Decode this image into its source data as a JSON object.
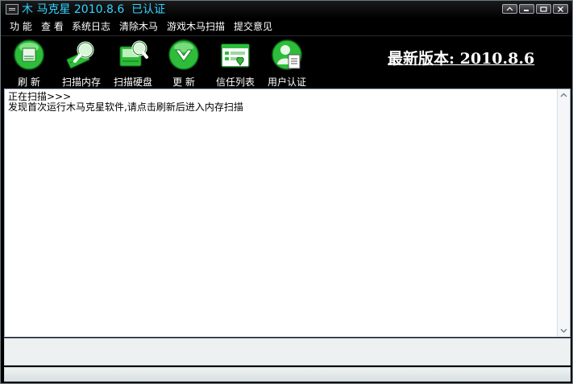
{
  "window": {
    "title": "木 马克星 2010.8.6  已认证",
    "controls": [
      "restore-icon",
      "minimize-icon",
      "maximize-icon",
      "close-icon"
    ]
  },
  "menu": {
    "items": [
      "功 能",
      "查 看",
      "系统日志",
      "清除木马",
      "游戏木马扫描",
      "提交意见"
    ]
  },
  "toolbar": {
    "buttons": [
      {
        "label": "刷 新",
        "icon": "refresh-icon"
      },
      {
        "label": "扫描内存",
        "icon": "scan-memory-icon"
      },
      {
        "label": "扫描硬盘",
        "icon": "scan-disk-icon"
      },
      {
        "label": "更 新",
        "icon": "update-icon"
      },
      {
        "label": "信任列表",
        "icon": "trust-list-icon"
      },
      {
        "label": "用户认证",
        "icon": "user-auth-icon"
      }
    ],
    "version_text": "最新版本: 2010.8.6"
  },
  "log": {
    "lines": [
      "正在扫描>>>",
      "发现首次运行木马克星软件,请点击刷新后进入内存扫描"
    ]
  },
  "colors": {
    "title": "#2fd4ff",
    "icon_green": "#2dbd3a",
    "background": "#000000",
    "content_bg": "#ffffff"
  }
}
